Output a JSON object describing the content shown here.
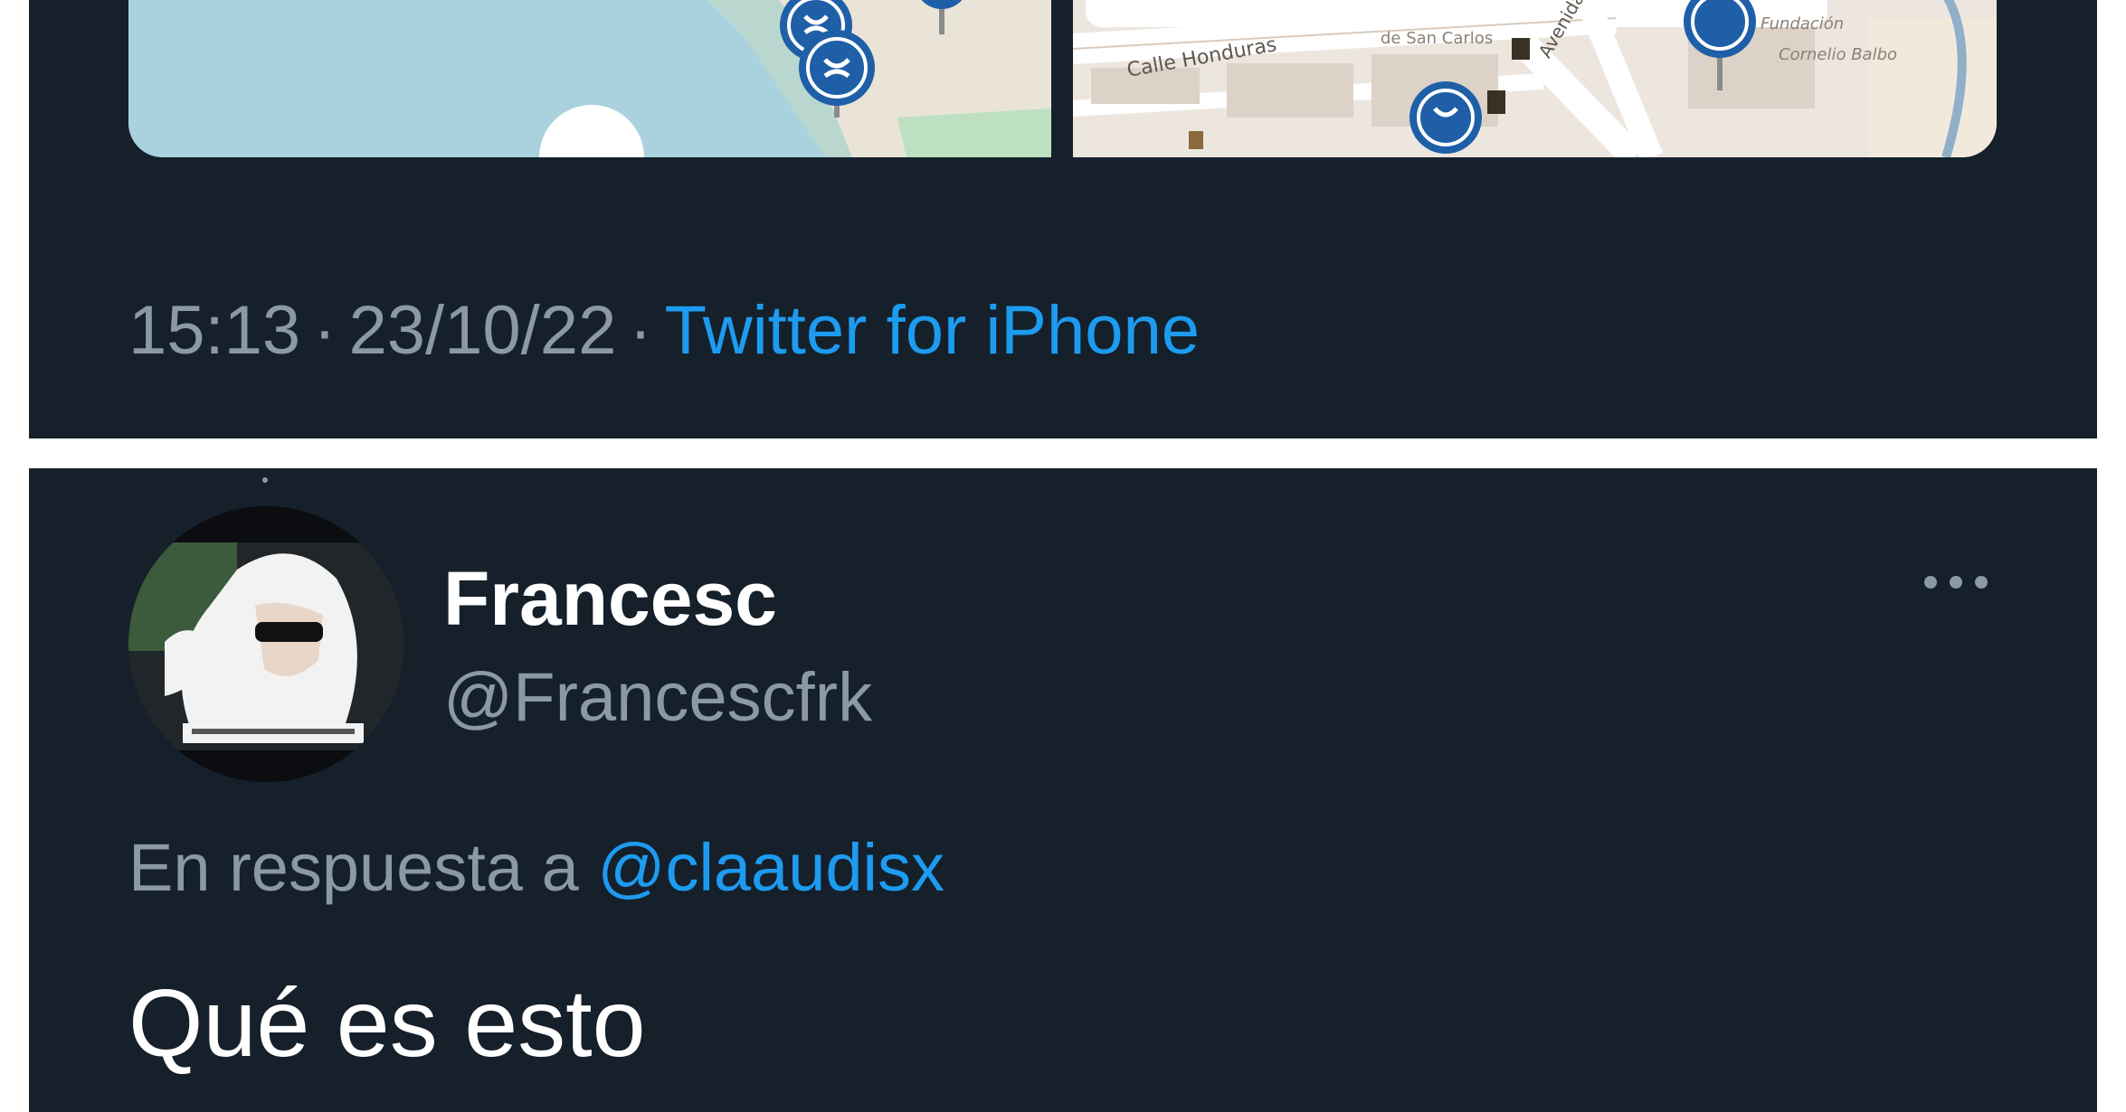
{
  "tweet_top": {
    "map_labels": {
      "street_honduras": "Calle Honduras",
      "street_avenida": "Avenida",
      "area_san_carlos": "de San Carlos",
      "area_fundacion": "Fundación",
      "area_cornelio": "Cornelio Balbo"
    },
    "time": "15:13",
    "separator": "·",
    "date": "23/10/22",
    "source": "Twitter for iPhone"
  },
  "tweet_reply": {
    "display_name": "Francesc",
    "handle": "@Francescfrk",
    "reply_prefix": "En respuesta a",
    "reply_mention": "@claaudisx",
    "text": "Qué es esto"
  },
  "colors": {
    "background": "#15202b",
    "accent": "#1d9bf0",
    "muted": "#8b98a5",
    "text": "#ffffff"
  },
  "icons": [
    "more-options-icon",
    "map-pin-icon",
    "avatar-image"
  ]
}
